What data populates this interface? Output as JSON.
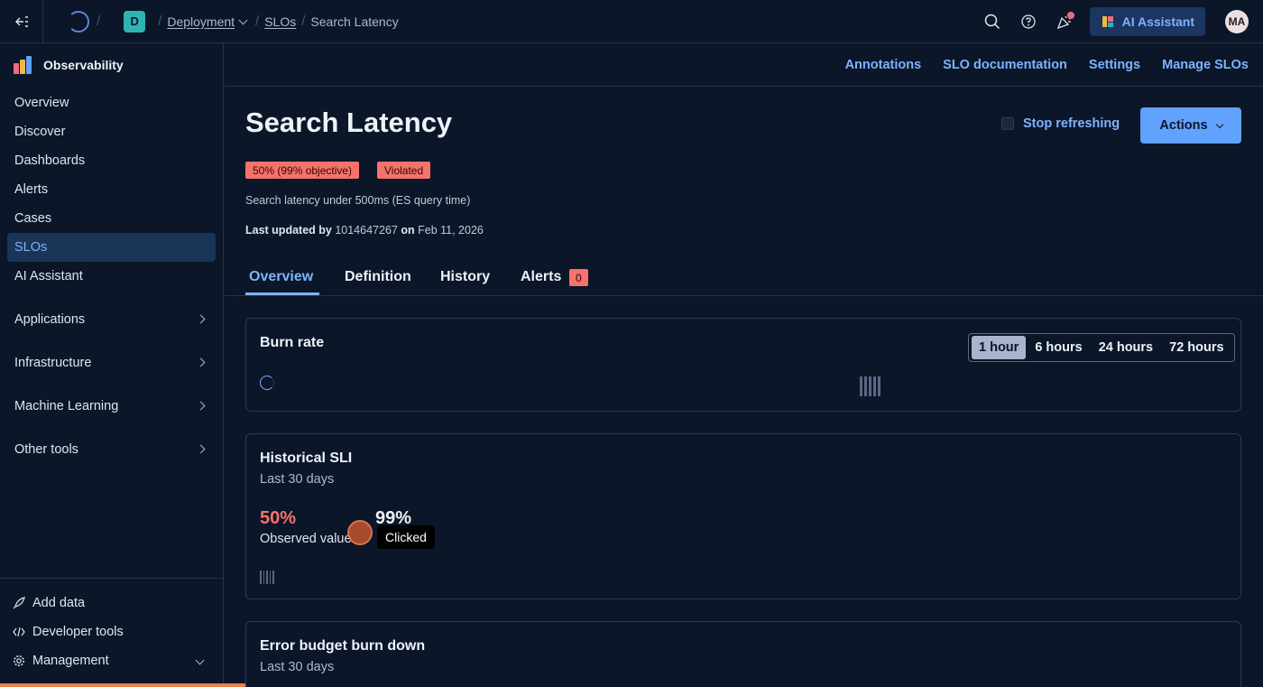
{
  "topbar": {
    "space_initial": "D",
    "breadcrumbs": [
      "Deployment",
      "SLOs",
      "Search Latency"
    ],
    "ai_assistant_label": "AI Assistant",
    "user_initials": "MA"
  },
  "sidebar": {
    "app_title": "Observability",
    "items": [
      {
        "label": "Overview"
      },
      {
        "label": "Discover"
      },
      {
        "label": "Dashboards"
      },
      {
        "label": "Alerts"
      },
      {
        "label": "Cases"
      },
      {
        "label": "SLOs",
        "active": true
      },
      {
        "label": "AI Assistant"
      },
      {
        "label": "Applications",
        "expandable": true
      },
      {
        "label": "Infrastructure",
        "expandable": true
      },
      {
        "label": "Machine Learning",
        "expandable": true
      },
      {
        "label": "Other tools",
        "expandable": true
      }
    ],
    "footer": {
      "add_data": "Add data",
      "developer_tools": "Developer tools",
      "management": "Management"
    }
  },
  "subnav": {
    "links": [
      "Annotations",
      "SLO documentation",
      "Settings",
      "Manage SLOs"
    ]
  },
  "header": {
    "title": "Search Latency",
    "stop_refreshing": "Stop refreshing",
    "actions_label": "Actions",
    "badges": [
      "50% (99% objective)",
      "Violated"
    ],
    "description": "Search latency under 500ms (ES query time)",
    "updated_prefix": "Last updated by",
    "updated_user": "1014647267",
    "updated_on": "on",
    "updated_date": "Feb 11, 2026"
  },
  "tabs": {
    "items": [
      "Overview",
      "Definition",
      "History",
      "Alerts"
    ],
    "alerts_count": "0",
    "active": "Overview"
  },
  "burn_rate": {
    "title": "Burn rate",
    "options": [
      "1 hour",
      "6 hours",
      "24 hours",
      "72 hours"
    ],
    "selected": "1 hour"
  },
  "historical_sli": {
    "title": "Historical SLI",
    "subtitle": "Last 30 days",
    "observed_value": "50%",
    "observed_label": "Observed value",
    "objective_value": "99%"
  },
  "error_budget": {
    "title": "Error budget burn down",
    "subtitle": "Last 30 days"
  },
  "overlay": {
    "tooltip": "Clicked"
  },
  "colors": {
    "accent": "#61a2ff",
    "link": "#7fb2ff",
    "danger": "#f6726a",
    "active_nav_bg": "#1a3558"
  }
}
